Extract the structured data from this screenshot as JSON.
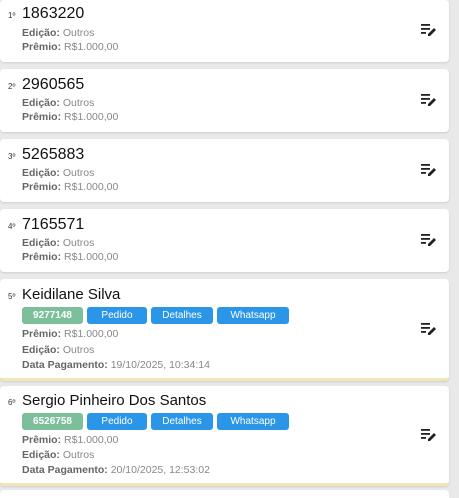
{
  "labels": {
    "edicao": "Edição:",
    "premio": "Prêmio:",
    "data_pagamento": "Data Pagamento:"
  },
  "items": [
    {
      "rank": "1º",
      "number": "1863220",
      "edicao": "Outros",
      "premio": "R$1.000,00"
    },
    {
      "rank": "2º",
      "number": "2960565",
      "edicao": "Outros",
      "premio": "R$1.000,00"
    },
    {
      "rank": "3º",
      "number": "5265883",
      "edicao": "Outros",
      "premio": "R$1.000,00"
    },
    {
      "rank": "4º",
      "number": "7165571",
      "edicao": "Outros",
      "premio": "R$1.000,00"
    }
  ],
  "winners": [
    {
      "rank": "5º",
      "name": "Keidilane Silva",
      "code": "9277148",
      "premio": "R$1.000,00",
      "edicao": "Outros",
      "data_pagamento": "19/10/2025, 10:34:14"
    },
    {
      "rank": "6º",
      "name": "Sergio Pinheiro Dos Santos",
      "code": "6526758",
      "premio": "R$1.000,00",
      "edicao": "Outros",
      "data_pagamento": "20/10/2025, 12:53:02"
    }
  ],
  "buttons": {
    "pedido": "Pedido",
    "detalhes": "Detalhes",
    "whatsapp": "Whatsapp"
  },
  "icons": {
    "edit": "playlist-edit-icon"
  },
  "colors": {
    "code_badge": "#7cbf9a",
    "action_button": "#2b96e8",
    "paid_accent": "#f1e6b8"
  }
}
